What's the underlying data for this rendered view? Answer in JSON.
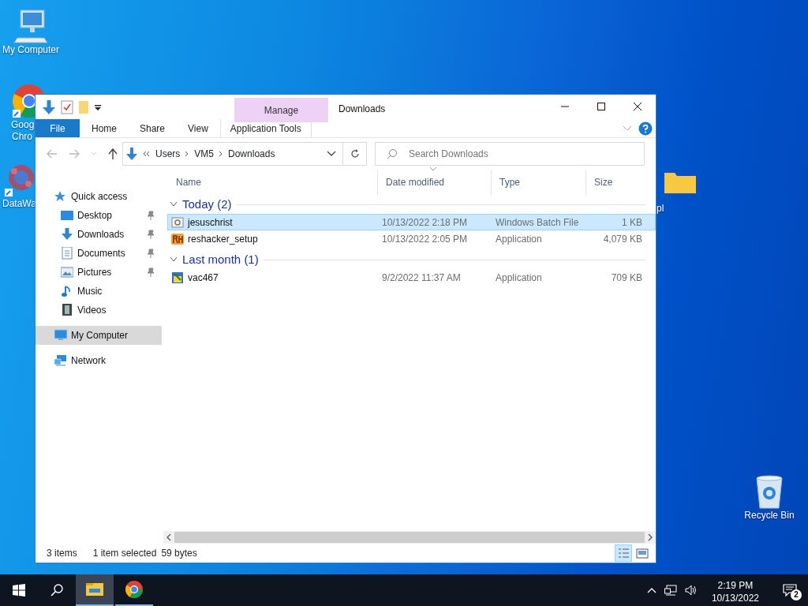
{
  "desktop_icons": [
    {
      "kind": "computer",
      "lines": [
        "My Computer"
      ]
    },
    {
      "kind": "chrome",
      "lines": [
        "Goog",
        "Chro"
      ]
    },
    {
      "kind": "data",
      "lines": [
        "DataWa"
      ]
    },
    {
      "kind": "folder",
      "lines": [
        "pl"
      ]
    },
    {
      "kind": "recycle",
      "lines": [
        "Recycle Bin"
      ]
    }
  ],
  "window": {
    "title": "Downloads",
    "context_group": "Manage",
    "tabs": [
      {
        "label": "File",
        "kind": "file"
      },
      {
        "label": "Home",
        "kind": "plain"
      },
      {
        "label": "Share",
        "kind": "plain"
      },
      {
        "label": "View",
        "kind": "plain"
      },
      {
        "label": "Application Tools",
        "kind": "contextual"
      }
    ],
    "breadcrumb": [
      "Users",
      "VM5",
      "Downloads"
    ],
    "search": {
      "placeholder": "Search Downloads"
    },
    "nav": [
      {
        "label": "Quick access",
        "kind": "star",
        "selected": false,
        "children": [
          {
            "label": "Desktop",
            "kind": "desktop",
            "pinned": true,
            "selected": false
          },
          {
            "label": "Downloads",
            "kind": "downloads",
            "pinned": true,
            "selected": false
          },
          {
            "label": "Documents",
            "kind": "documents",
            "pinned": true,
            "selected": false
          },
          {
            "label": "Pictures",
            "kind": "pictures",
            "pinned": true,
            "selected": false
          },
          {
            "label": "Music",
            "kind": "music",
            "pinned": false,
            "selected": false
          },
          {
            "label": "Videos",
            "kind": "videos",
            "pinned": false,
            "selected": false
          }
        ]
      },
      {
        "label": "My Computer",
        "kind": "computer",
        "selected": true
      },
      {
        "label": "Network",
        "kind": "network",
        "selected": false
      }
    ],
    "columns": [
      "Name",
      "Date modified",
      "Type",
      "Size"
    ],
    "groups": [
      {
        "label": "Today (2)",
        "expanded": true,
        "rows": [
          {
            "name": "jesuschrist",
            "kind": "batch",
            "date": "10/13/2022 2:18 PM",
            "type": "Windows Batch File",
            "size": "1 KB",
            "selected": true
          },
          {
            "name": "reshacker_setup",
            "kind": "rh",
            "date": "10/13/2022 2:05 PM",
            "type": "Application",
            "size": "4,079 KB",
            "selected": false
          }
        ]
      },
      {
        "label": "Last month (1)",
        "expanded": true,
        "rows": [
          {
            "name": "vac467",
            "kind": "setup",
            "date": "9/2/2022 11:37 AM",
            "type": "Application",
            "size": "709 KB",
            "selected": false
          }
        ]
      }
    ],
    "status": [
      "3 items",
      "1 item selected",
      "59 bytes"
    ],
    "views": [
      {
        "kind": "details",
        "selected": true
      },
      {
        "kind": "thumbs",
        "selected": false
      }
    ]
  },
  "taskbar": {
    "apps": [
      {
        "kind": "explorer",
        "active": true
      },
      {
        "kind": "chrome",
        "active": false
      }
    ],
    "time": "2:19 PM",
    "date": "10/13/2022",
    "notifications": "2"
  }
}
